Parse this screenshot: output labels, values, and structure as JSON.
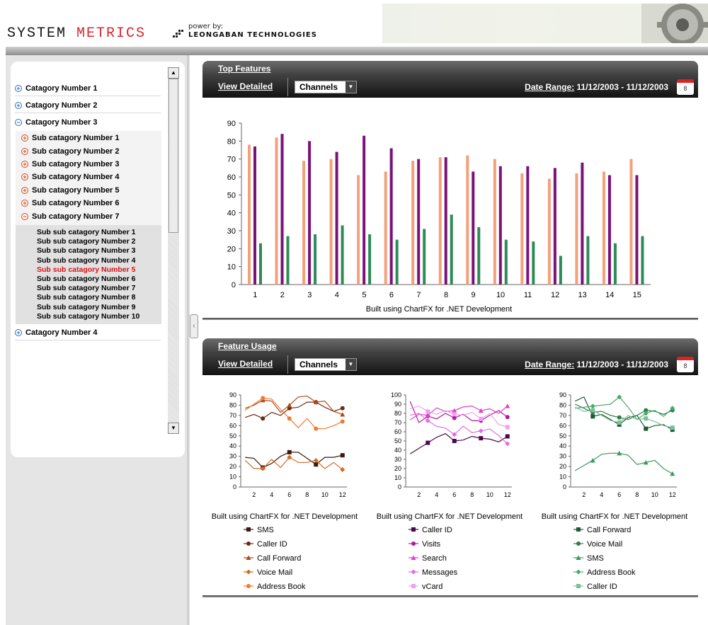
{
  "header": {
    "logo_part1": "SYSTEM ",
    "logo_part2": "METRICS",
    "powered_by": "power by:",
    "company": "LEONGABAN TECHNOLOGIES"
  },
  "nav": {
    "categories": [
      {
        "label": "Catagory Number 1",
        "state": "collapsed"
      },
      {
        "label": "Catagory Number 2",
        "state": "collapsed"
      },
      {
        "label": "Catagory Number 3",
        "state": "expanded"
      },
      {
        "label": "Catagory Number 4",
        "state": "collapsed"
      }
    ],
    "subcategories": [
      "Sub catagory Number 1",
      "Sub catagory Number 2",
      "Sub catagory Number 3",
      "Sub catagory Number 4",
      "Sub catagory Number 5",
      "Sub catagory Number 6",
      "Sub catagory Number 7"
    ],
    "subsubcategories": [
      "Sub sub catagory Number 1",
      "Sub sub catagory Number 2",
      "Sub sub catagory Number 3",
      "Sub sub catagory Number 4",
      "Sub sub catagory Number 5",
      "Sub sub catagory Number 6",
      "Sub sub catagory Number 7",
      "Sub sub catagory Number 8",
      "Sub sub catagory Number 9",
      "Sub sub catagory Number 10"
    ],
    "active_subsub": 4
  },
  "top_panel": {
    "title": "Top Features",
    "view_detailed": "View Detailed",
    "channel": "Channels",
    "date_label": "Date Range:",
    "date_value": "11/12/2003 - 11/12/2003",
    "calendar_day": "8"
  },
  "usage_panel": {
    "title": "Feature Usage",
    "view_detailed": "View Detailed",
    "channel": "Channels",
    "date_label": "Date Range:",
    "date_value": "11/12/2003 - 11/12/2003",
    "calendar_day": "8"
  },
  "colors": {
    "orange": "#f4a07a",
    "purple": "#7a127a",
    "green": "#2e8b57"
  },
  "chart_data": [
    {
      "type": "bar",
      "title": "",
      "xlabel": "Built using ChartFX for .NET Development",
      "ylim": [
        0,
        90
      ],
      "yticks": [
        0,
        10,
        20,
        30,
        40,
        50,
        60,
        70,
        80,
        90
      ],
      "categories": [
        "1",
        "2",
        "3",
        "4",
        "5",
        "6",
        "7",
        "8",
        "9",
        "10",
        "11",
        "12",
        "13",
        "14",
        "15"
      ],
      "series": [
        {
          "color": "#f4a07a",
          "values": [
            78,
            82,
            69,
            70,
            61,
            63,
            69,
            71,
            72,
            70,
            62,
            59,
            62,
            63,
            70
          ]
        },
        {
          "color": "#7a127a",
          "values": [
            77,
            84,
            80,
            74,
            83,
            76,
            70,
            71,
            63,
            66,
            66,
            65,
            68,
            61,
            61
          ]
        },
        {
          "color": "#2e8b57",
          "values": [
            23,
            27,
            28,
            33,
            28,
            25,
            31,
            39,
            32,
            25,
            24,
            16,
            27,
            23,
            27
          ]
        }
      ]
    },
    {
      "type": "line",
      "xlabel": "Built using ChartFX for .NET Development",
      "ylim": [
        0,
        90
      ],
      "yticks": [
        0,
        10,
        20,
        30,
        40,
        50,
        60,
        70,
        80,
        90
      ],
      "xticks": [
        2,
        4,
        6,
        8,
        10,
        12
      ],
      "x": [
        1,
        2,
        3,
        4,
        5,
        6,
        7,
        8,
        9,
        10,
        11,
        12
      ],
      "series": [
        {
          "name": "SMS",
          "color": "#3a1a10",
          "marker": "square",
          "values": [
            29,
            28,
            19,
            23,
            30,
            34,
            34,
            28,
            22,
            29,
            29,
            31
          ]
        },
        {
          "name": "Caller ID",
          "color": "#6b2a10",
          "marker": "circle",
          "values": [
            68,
            71,
            67,
            73,
            70,
            77,
            78,
            83,
            83,
            78,
            74,
            77
          ]
        },
        {
          "name": "Call Forward",
          "color": "#b04a18",
          "marker": "triangle",
          "values": [
            77,
            80,
            85,
            84,
            73,
            80,
            88,
            89,
            83,
            84,
            74,
            71
          ]
        },
        {
          "name": "Voice Mail",
          "color": "#d66a20",
          "marker": "diamond",
          "values": [
            26,
            18,
            18,
            27,
            19,
            29,
            24,
            24,
            26,
            18,
            24,
            17
          ]
        },
        {
          "name": "Address Book",
          "color": "#f07a30",
          "marker": "circle",
          "values": [
            75,
            81,
            87,
            86,
            76,
            67,
            58,
            67,
            57,
            57,
            60,
            64
          ]
        }
      ]
    },
    {
      "type": "line",
      "xlabel": "Built using ChartFX for .NET Development",
      "ylim": [
        0,
        100
      ],
      "yticks": [
        0,
        10,
        20,
        30,
        40,
        50,
        60,
        70,
        80,
        90,
        100
      ],
      "xticks": [
        2,
        4,
        6,
        8,
        10,
        12
      ],
      "x": [
        1,
        2,
        3,
        4,
        5,
        6,
        7,
        8,
        9,
        10,
        11,
        12
      ],
      "series": [
        {
          "name": "Caller ID",
          "color": "#4a0a4a",
          "marker": "square",
          "values": [
            36,
            42,
            48,
            54,
            58,
            50,
            51,
            55,
            53,
            52,
            49,
            55
          ]
        },
        {
          "name": "Visits",
          "color": "#b01aa0",
          "marker": "circle",
          "values": [
            93,
            70,
            77,
            74,
            80,
            75,
            79,
            72,
            72,
            78,
            83,
            76
          ]
        },
        {
          "name": "Search",
          "color": "#e040d0",
          "marker": "triangle",
          "values": [
            73,
            79,
            78,
            86,
            82,
            83,
            87,
            88,
            83,
            85,
            80,
            88
          ]
        },
        {
          "name": "Messages",
          "color": "#e070e0",
          "marker": "diamond",
          "values": [
            78,
            80,
            72,
            66,
            64,
            57,
            66,
            59,
            61,
            63,
            56,
            47
          ]
        },
        {
          "name": "vCard",
          "color": "#f0a0f0",
          "marker": "square",
          "values": [
            85,
            88,
            82,
            79,
            83,
            79,
            78,
            81,
            74,
            80,
            68,
            65
          ]
        }
      ]
    },
    {
      "type": "line",
      "xlabel": "Built using ChartFX for .NET Development",
      "ylim": [
        0,
        90
      ],
      "yticks": [
        0,
        10,
        20,
        30,
        40,
        50,
        60,
        70,
        80,
        90
      ],
      "xticks": [
        2,
        4,
        6,
        8,
        10,
        12
      ],
      "x": [
        1,
        2,
        3,
        4,
        5,
        6,
        7,
        8,
        9,
        10,
        11,
        12
      ],
      "series": [
        {
          "name": "Call Forward",
          "color": "#1e5a30",
          "marker": "square",
          "values": [
            84,
            88,
            69,
            71,
            66,
            61,
            68,
            70,
            57,
            60,
            61,
            56
          ]
        },
        {
          "name": "Voice Mail",
          "color": "#2e7a4a",
          "marker": "circle",
          "values": [
            81,
            77,
            73,
            74,
            70,
            68,
            66,
            70,
            75,
            74,
            71,
            75
          ]
        },
        {
          "name": "SMS",
          "color": "#3a9a5a",
          "marker": "triangle",
          "values": [
            16,
            21,
            26,
            32,
            33,
            33,
            31,
            22,
            24,
            26,
            18,
            13
          ]
        },
        {
          "name": "Address Book",
          "color": "#4aaa6a",
          "marker": "diamond",
          "values": [
            77,
            78,
            79,
            80,
            81,
            88,
            78,
            66,
            72,
            75,
            69,
            77
          ]
        },
        {
          "name": "Caller ID",
          "color": "#7ac09a",
          "marker": "square",
          "values": [
            78,
            74,
            75,
            70,
            65,
            63,
            70,
            66,
            67,
            64,
            60,
            58
          ]
        }
      ]
    }
  ]
}
